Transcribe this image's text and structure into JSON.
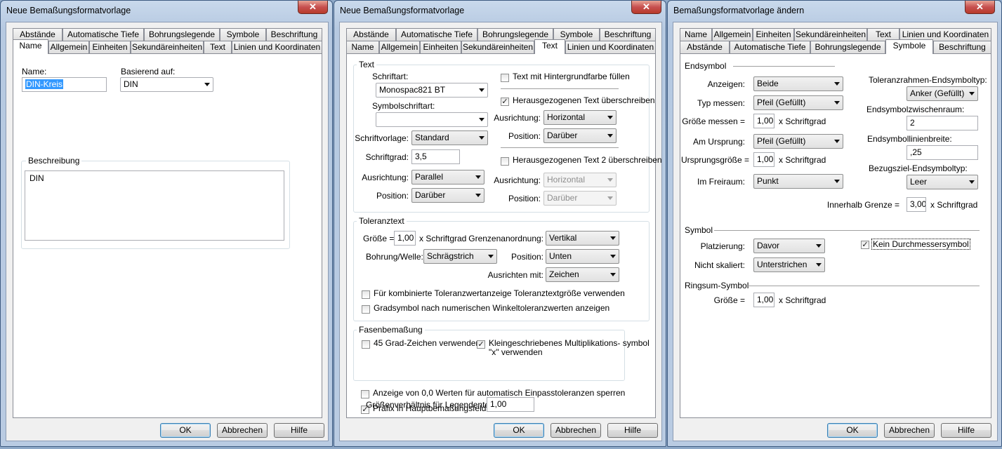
{
  "windows": [
    {
      "title": "Neue Bemaßungsformatvorlage",
      "close": "✕",
      "tabs_back": [
        "Abstände",
        "Automatische Tiefe",
        "Bohrungslegende",
        "Symbole",
        "Beschriftung"
      ],
      "tabs_front": [
        "Name",
        "Allgemein",
        "Einheiten",
        "Sekundäreinheiten",
        "Text",
        "Linien und Koordinaten"
      ],
      "active_tab": "Name",
      "name_label": "Name:",
      "name_value": "DIN-Kreis",
      "based_on_label": "Basierend auf:",
      "based_on_value": "DIN",
      "description_label": "Beschreibung",
      "description_value": "DIN",
      "buttons": {
        "ok": "OK",
        "cancel": "Abbrechen",
        "help": "Hilfe"
      }
    },
    {
      "title": "Neue Bemaßungsformatvorlage",
      "close": "✕",
      "tabs_back": [
        "Abstände",
        "Automatische Tiefe",
        "Bohrungslegende",
        "Symbole",
        "Beschriftung"
      ],
      "tabs_front": [
        "Name",
        "Allgemein",
        "Einheiten",
        "Sekundäreinheiten",
        "Text",
        "Linien und Koordinaten"
      ],
      "active_tab": "Text",
      "text_group": {
        "title": "Text",
        "font_label": "Schriftart:",
        "font_value": "Monospac821 BT",
        "symbol_font_label": "Symbolschriftart:",
        "symbol_font_value": "",
        "style_label": "Schriftvorlage:",
        "style_value": "Standard",
        "size_label": "Schriftgrad:",
        "size_value": "3,5",
        "align_label": "Ausrichtung:",
        "align_value": "Parallel",
        "position_label": "Position:",
        "position_value": "Darüber",
        "bgfill_label": "Text mit Hintergrundfarbe füllen",
        "override1_label": "Herausgezogenen Text überschreiben",
        "align1_label": "Ausrichtung:",
        "align1_value": "Horizontal",
        "position1_label": "Position:",
        "position1_value": "Darüber",
        "override2_label": "Herausgezogenen Text 2 überschreiben",
        "align2_label": "Ausrichtung:",
        "align2_value": "Horizontal",
        "position2_label": "Position:",
        "position2_value": "Darüber"
      },
      "tolerance_group": {
        "title": "Toleranztext",
        "size_label": "Größe =",
        "size_value": "1,00",
        "size_unit": "x Schriftgrad",
        "limits_label": "Grenzenanordnung:",
        "limits_value": "Vertikal",
        "hole_label": "Bohrung/Welle:",
        "hole_value": "Schrägstrich",
        "position_label": "Position:",
        "position_value": "Unten",
        "alignto_label": "Ausrichten mit:",
        "alignto_value": "Zeichen",
        "combined_label": "Für kombinierte Toleranzwertanzeige Toleranztextgröße verwenden",
        "degree_label": "Gradsymbol nach numerischen Winkeltoleranzwerten anzeigen"
      },
      "chamfer_group": {
        "title": "Fasenbemaßung",
        "deg45_label": "45 Grad-Zeichen verwenden",
        "lowercase_label1": "Kleingeschriebenes Multiplikations- symbol",
        "lowercase_label2": "\"x\" verwenden"
      },
      "suppress_zero_label": "Anzeige von 0,0 Werten für automatisch Einpasstoleranzen sperren",
      "prefix_label": "Präfix in Hauptbemaßungsfeld setzen",
      "ratio_label": "Größenverhältnis für Legendentext:",
      "ratio_value": "1,00",
      "buttons": {
        "ok": "OK",
        "cancel": "Abbrechen",
        "help": "Hilfe"
      }
    },
    {
      "title": "Bemaßungsformatvorlage ändern",
      "close": "✕",
      "tabs_back": [
        "Name",
        "Allgemein",
        "Einheiten",
        "Sekundäreinheiten",
        "Text",
        "Linien und Koordinaten"
      ],
      "tabs_front": [
        "Abstände",
        "Automatische Tiefe",
        "Bohrungslegende",
        "Symbole",
        "Beschriftung"
      ],
      "active_tab": "Symbole",
      "end_group": {
        "title": "Endsymbol",
        "show_label": "Anzeigen:",
        "show_value": "Beide",
        "type_label": "Typ messen:",
        "type_value": "Pfeil (Gefüllt)",
        "size_label": "Größe messen =",
        "size_value": "1,00",
        "size_unit": "x Schriftgrad",
        "origin_label": "Am Ursprung:",
        "origin_value": "Pfeil (Gefüllt)",
        "origin_size_label": "Ursprungsgröße =",
        "origin_size_value": "1,00",
        "origin_size_unit": "x Schriftgrad",
        "free_label": "Im Freiraum:",
        "free_value": "Punkt",
        "tolframe_label": "Toleranzrahmen-Endsymboltyp:",
        "tolframe_value": "Anker (Gefüllt)",
        "gap_label": "Endsymbolzwischenraum:",
        "gap_value": "2",
        "linewidth_label": "Endsymbollinienbreite:",
        "linewidth_value": ",25",
        "ref_label": "Bezugsziel-Endsymboltyp:",
        "ref_value": "Leer",
        "inside_label": "Innerhalb Grenze =",
        "inside_value": "3,00",
        "inside_unit": "x Schriftgrad"
      },
      "symbol_group": {
        "title": "Symbol",
        "placement_label": "Platzierung:",
        "placement_value": "Davor",
        "notscaled_label": "Nicht skaliert:",
        "notscaled_value": "Unterstrichen",
        "nodiameter_label": "Kein Durchmessersymbol"
      },
      "around_group": {
        "title": "Ringsum-Symbol",
        "size_label": "Größe =",
        "size_value": "1,00",
        "size_unit": "x Schriftgrad"
      },
      "buttons": {
        "ok": "OK",
        "cancel": "Abbrechen",
        "help": "Hilfe"
      }
    }
  ],
  "colors": {
    "titlebar": "#c9d9ec",
    "close_button": "#c75050",
    "dialog_bg": "#f0f0f0",
    "panel_bg": "#ffffff",
    "selection": "#3399ff"
  }
}
